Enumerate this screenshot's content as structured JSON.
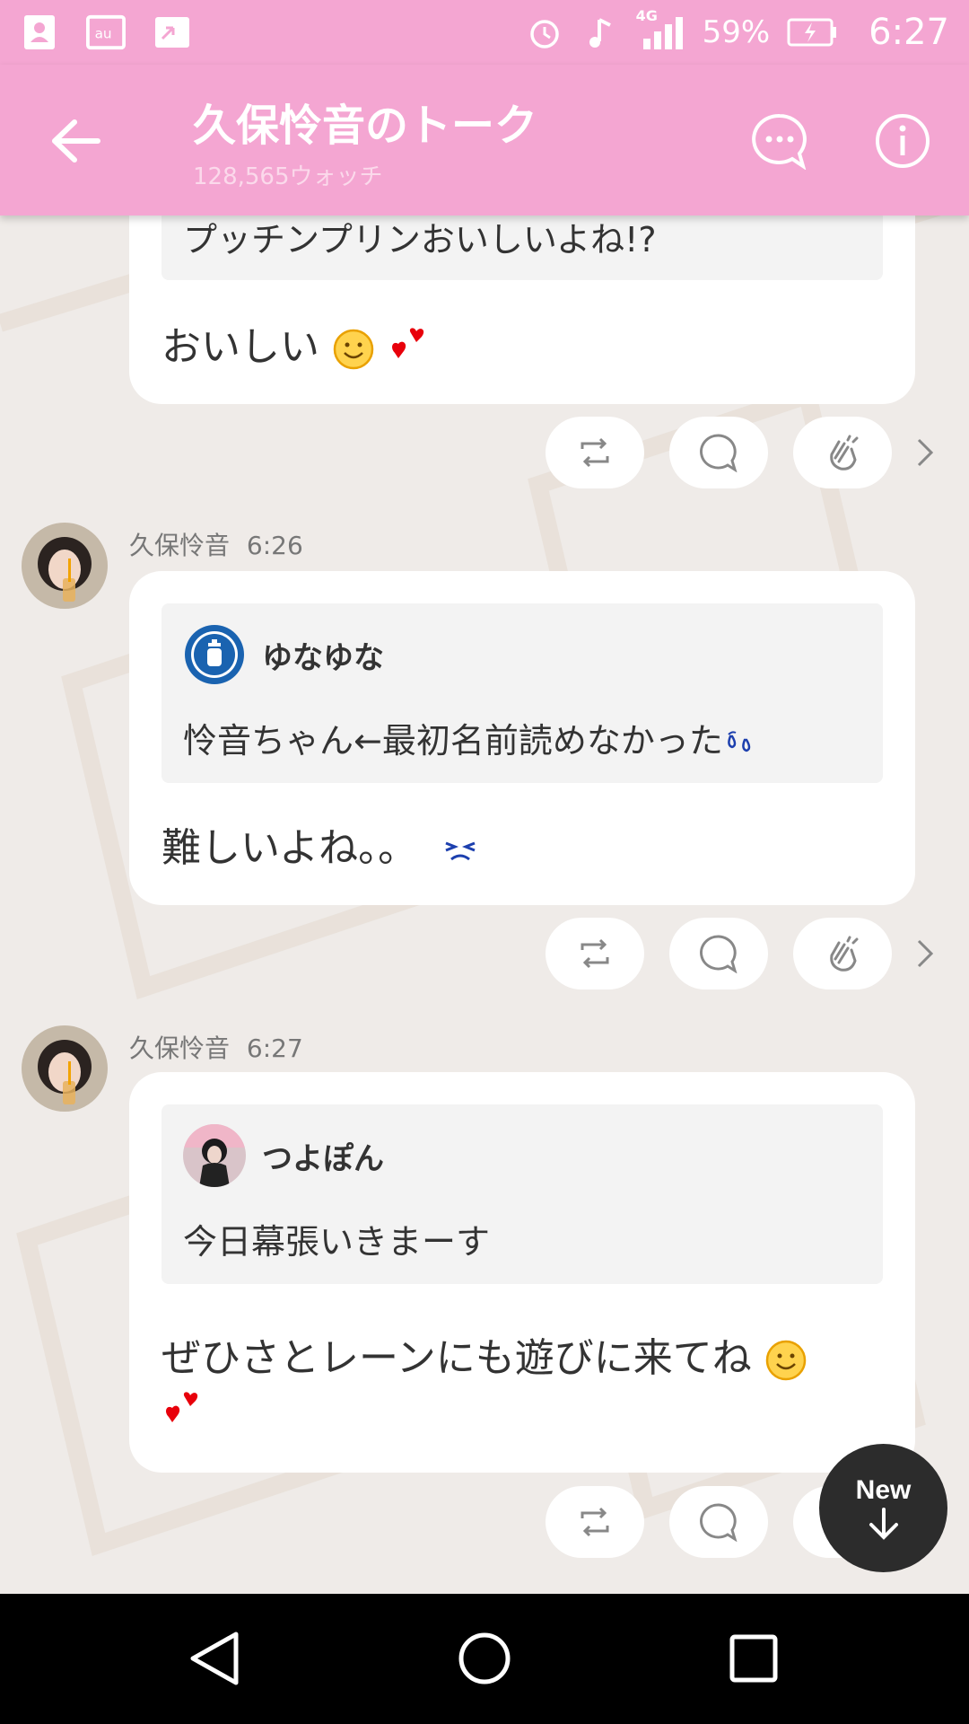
{
  "status_bar": {
    "signal_label": "4G",
    "battery": "59%",
    "time": "6:27",
    "icons": [
      "contacts-icon",
      "au-icon",
      "transfer-icon",
      "alarm-icon",
      "music-icon",
      "signal-icon",
      "battery-charging-icon"
    ]
  },
  "header": {
    "title": "久保怜音のトーク",
    "watchers": "128,565ウォッチ",
    "bg_color": "#f4a6d2"
  },
  "messages": {
    "partial": {
      "quote_text": "プッチンプリンおいしいよね!?",
      "text": "おいしい"
    },
    "m1": {
      "sender": "久保怜音",
      "time": "6:26",
      "quote_name": "ゆなゆな",
      "quote_text": "怜音ちゃん←最初名前読めなかった",
      "text": "難しいよね。。"
    },
    "m2": {
      "sender": "久保怜音",
      "time": "6:27",
      "quote_name": "つよぽん",
      "quote_text": "今日幕張いきまーす",
      "text": "ぜひさとレーンにも遊びに来てね"
    }
  },
  "new_button": {
    "label": "New"
  }
}
